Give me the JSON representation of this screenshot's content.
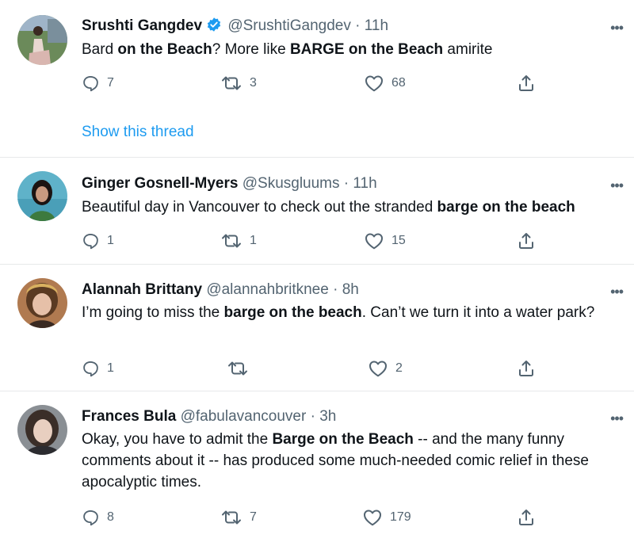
{
  "tweets": [
    {
      "name": "Srushti Gangdev",
      "handle": "@SrushtiGangdev",
      "time": "· 11h",
      "verified": true,
      "segments": [
        {
          "t": "Bard ",
          "b": false
        },
        {
          "t": "on the Beach",
          "b": true
        },
        {
          "t": "? More like ",
          "b": false
        },
        {
          "t": "BARGE on the Beach",
          "b": true
        },
        {
          "t": " amirite",
          "b": false
        }
      ],
      "replies": "7",
      "retweets": "3",
      "likes": "68",
      "thread_link": "Show this thread",
      "more_icon": "•••"
    },
    {
      "name": "Ginger Gosnell-Myers",
      "handle": "@Skusgluums",
      "time": "· 11h",
      "verified": false,
      "segments": [
        {
          "t": "Beautiful day in Vancouver to check out the stranded ",
          "b": false
        },
        {
          "t": "barge on the beach",
          "b": true
        }
      ],
      "replies": "1",
      "retweets": "1",
      "likes": "15",
      "more_icon": "•••"
    },
    {
      "name": "Alannah Brittany",
      "handle": "@alannahbritknee",
      "time": "· 8h",
      "verified": false,
      "segments": [
        {
          "t": "I’m going to miss the ",
          "b": false
        },
        {
          "t": "barge on the beach",
          "b": true
        },
        {
          "t": ". Can’t we turn it into a water park?",
          "b": false
        }
      ],
      "replies": "1",
      "retweets": "",
      "likes": "2",
      "more_icon": "•••"
    },
    {
      "name": "Frances Bula",
      "handle": "@fabulavancouver",
      "time": "· 3h",
      "verified": false,
      "segments": [
        {
          "t": "Okay, you have to admit the ",
          "b": false
        },
        {
          "t": "Barge on the Beach",
          "b": true
        },
        {
          "t": " -- and the many funny comments about it -- has produced some much-needed comic relief in these apocalyptic times.",
          "b": false
        }
      ],
      "replies": "8",
      "retweets": "7",
      "likes": "179",
      "more_icon": "•••"
    }
  ],
  "colors": {
    "text": "#0f1419",
    "muted": "#536471",
    "link": "#1d9bf0",
    "verified_badge": "#1d9bf0",
    "divider": "#e7e9ea"
  },
  "icons": {
    "reply": "reply-icon",
    "retweet": "retweet-icon",
    "like": "like-icon",
    "share": "share-icon",
    "more": "more-icon",
    "verified": "verified-badge-icon"
  }
}
